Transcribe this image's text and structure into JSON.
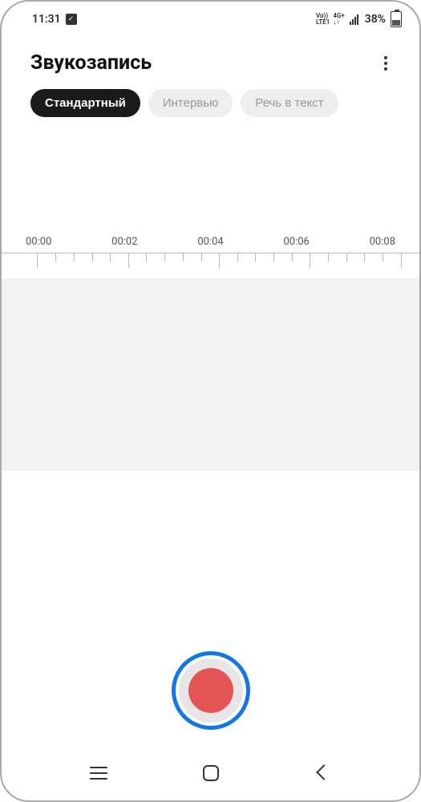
{
  "status": {
    "time": "11:31",
    "net1": "Vo))",
    "net2": "LTE1",
    "net3": "4G+",
    "arrows": "↓↑",
    "battery_percent": "38%"
  },
  "header": {
    "title": "Звукозапись"
  },
  "tabs": [
    {
      "label": "Стандартный",
      "active": true
    },
    {
      "label": "Интервью",
      "active": false
    },
    {
      "label": "Речь в текст",
      "active": false
    }
  ],
  "timeline": {
    "labels": [
      "00:00",
      "00:02",
      "00:04",
      "00:06",
      "00:08"
    ]
  }
}
